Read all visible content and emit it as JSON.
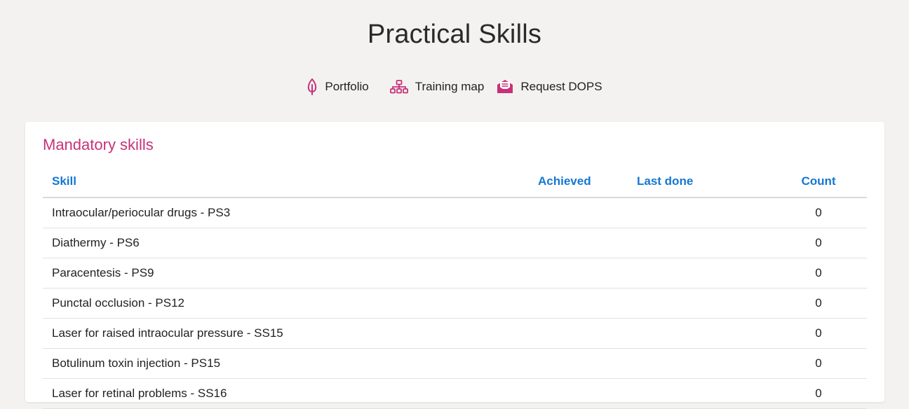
{
  "page": {
    "title": "Practical Skills"
  },
  "nav": {
    "portfolio": {
      "label": "Portfolio",
      "icon": "leaf-icon"
    },
    "training_map": {
      "label": "Training map",
      "icon": "sitemap-icon"
    },
    "request_dops": {
      "label": "Request DOPS",
      "icon": "envelope-open-icon"
    }
  },
  "mandatory": {
    "title": "Mandatory skills",
    "columns": {
      "skill": "Skill",
      "achieved": "Achieved",
      "last_done": "Last done",
      "count": "Count"
    },
    "rows": [
      {
        "skill": "Intraocular/periocular drugs - PS3",
        "achieved": "",
        "last_done": "",
        "count": "0"
      },
      {
        "skill": "Diathermy - PS6",
        "achieved": "",
        "last_done": "",
        "count": "0"
      },
      {
        "skill": "Paracentesis - PS9",
        "achieved": "",
        "last_done": "",
        "count": "0"
      },
      {
        "skill": "Punctal occlusion - PS12",
        "achieved": "",
        "last_done": "",
        "count": "0"
      },
      {
        "skill": "Laser for raised intraocular pressure - SS15",
        "achieved": "",
        "last_done": "",
        "count": "0"
      },
      {
        "skill": "Botulinum toxin injection - PS15",
        "achieved": "",
        "last_done": "",
        "count": "0"
      },
      {
        "skill": "Laser for retinal problems - SS16",
        "achieved": "",
        "last_done": "",
        "count": "0"
      }
    ]
  },
  "colors": {
    "accent": "#c8317a",
    "link": "#1477d2",
    "background": "#f3f2f0"
  }
}
